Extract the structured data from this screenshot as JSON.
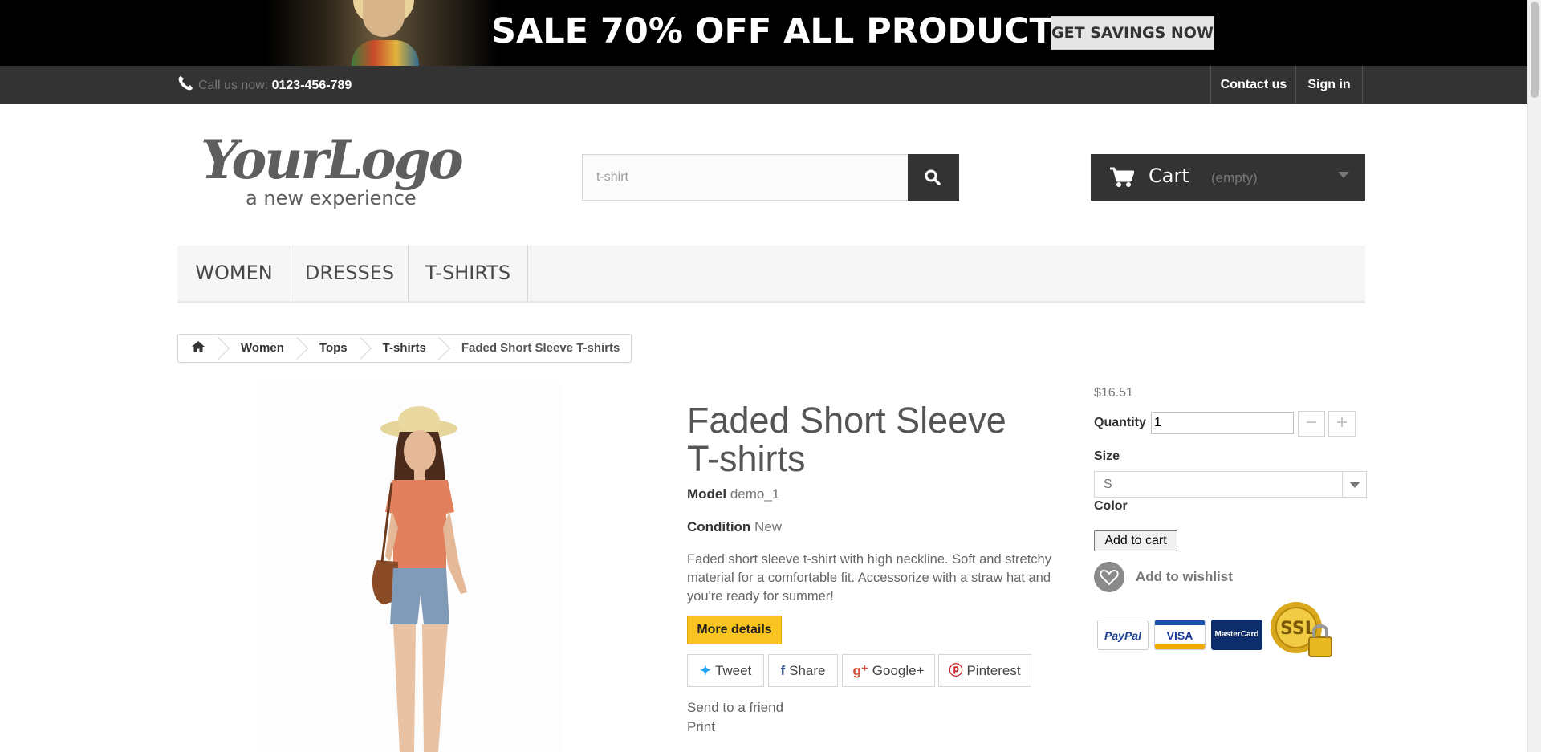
{
  "banner": {
    "headline": "SALE 70% OFF ALL PRODUCTS",
    "cta": "GET SAVINGS NOW"
  },
  "topbar": {
    "call_label": "Call us now:",
    "phone": "0123-456-789",
    "contact": "Contact us",
    "signin": "Sign in"
  },
  "header": {
    "search": {
      "value": "t-shirt"
    },
    "cart": {
      "label": "Cart",
      "status": "(empty)"
    }
  },
  "menu": {
    "items": [
      "WOMEN",
      "DRESSES",
      "T-SHIRTS"
    ]
  },
  "breadcrumb": {
    "items": [
      "Women",
      "Tops",
      "T-shirts"
    ],
    "current": "Faded Short Sleeve T-shirts"
  },
  "product": {
    "title_line1": "Faded Short Sleeve",
    "title_line2": "T-shirts",
    "model_label": "Model",
    "model_value": "demo_1",
    "condition_label": "Condition",
    "condition_value": "New",
    "description": "Faded short sleeve t-shirt with high neckline. Soft and stretchy material for a comfortable fit. Accessorize with a straw hat and you're ready for summer!",
    "more_details": "More details",
    "share": {
      "tweet": "Tweet",
      "share": "Share",
      "gplus": "Google+",
      "pinterest": "Pinterest"
    },
    "send_friend": "Send to a friend",
    "print": "Print"
  },
  "buybox": {
    "price": "$16.51",
    "quantity_label": "Quantity",
    "quantity_value": "1",
    "size_label": "Size",
    "size_value": "S",
    "color_label": "Color",
    "add_to_cart": "Add to cart",
    "wishlist": "Add to wishlist",
    "payments": {
      "paypal": "PayPal",
      "visa": "VISA",
      "mastercard": "MasterCard",
      "ssl": "SSL"
    }
  },
  "colors": {
    "banner_bg": "#000000",
    "topbar_bg": "#333333",
    "more_details_bg": "#f9c322",
    "menu_bg": "#f6f6f6"
  }
}
